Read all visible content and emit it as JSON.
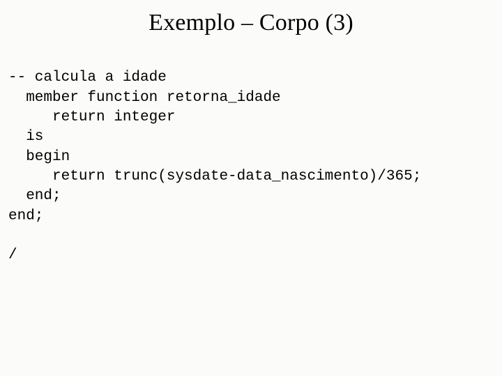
{
  "title": "Exemplo – Corpo (3)",
  "code": {
    "l1": "-- calcula a idade",
    "l2": "  member function retorna_idade",
    "l3": "     return integer",
    "l4": "  is",
    "l5": "  begin",
    "l6": "     return trunc(sysdate-data_nascimento)/365;",
    "l7": "  end;",
    "l8": "end;",
    "l9": "",
    "l10": "/"
  }
}
